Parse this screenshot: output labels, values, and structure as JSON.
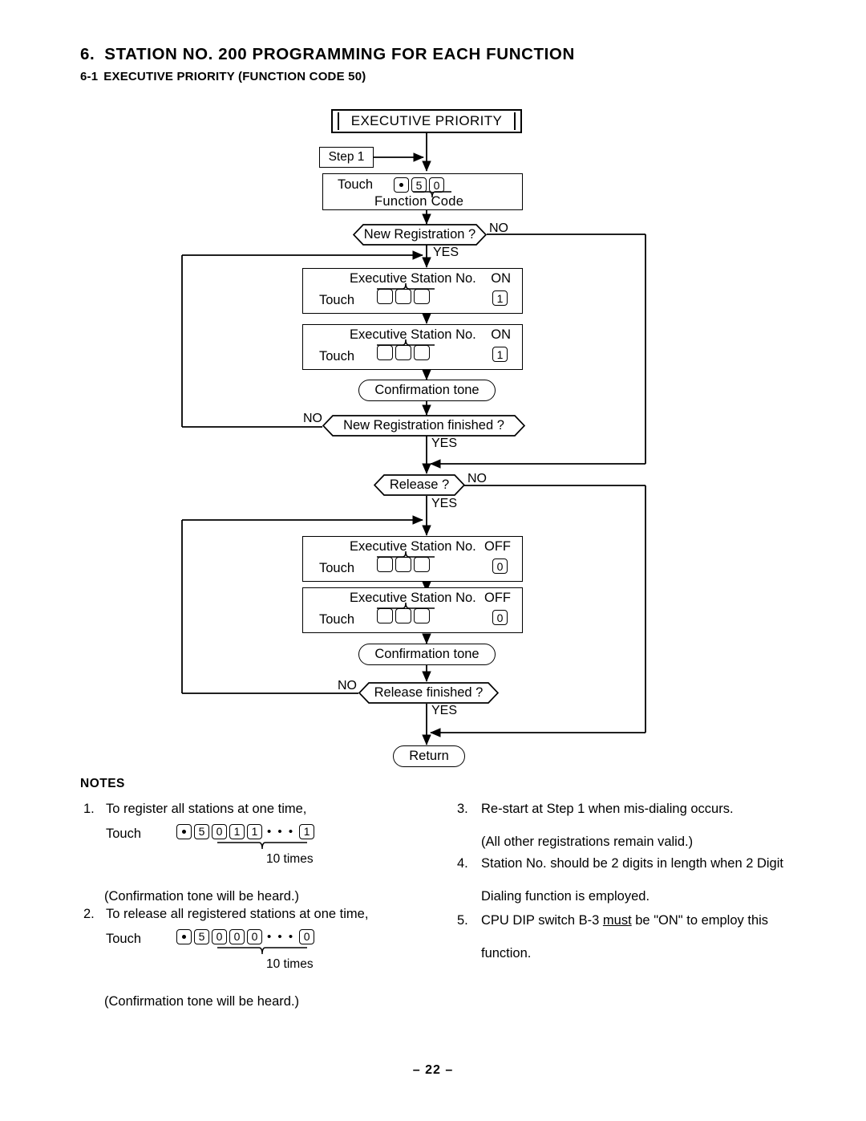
{
  "heading": {
    "section_number": "6.",
    "section_title": "STATION  NO. 200  PROGRAMMING  FOR  EACH  FUNCTION",
    "subsection_number": "6-1",
    "subsection_title": "EXECUTIVE PRIORITY (FUNCTION CODE 50)"
  },
  "flowchart": {
    "banner": "EXECUTIVE  PRIORITY",
    "step1": "Step 1",
    "function_code_box": {
      "touch_label": "Touch",
      "keys": [
        "•",
        "5",
        "0"
      ],
      "caption": "Function  Code"
    },
    "decision_new_registration": {
      "label": "New Registration ?",
      "yes": "YES",
      "no": "NO"
    },
    "on_box_1": {
      "header": "Executive Station No.",
      "state": "ON",
      "touch_label": "Touch",
      "blank_keys": [
        "",
        "",
        ""
      ],
      "state_key": "1"
    },
    "on_box_2": {
      "header": "Executive Station No.",
      "state": "ON",
      "touch_label": "Touch",
      "blank_keys": [
        "",
        "",
        ""
      ],
      "state_key": "1"
    },
    "confirmation_tone_1": "Confirmation tone",
    "decision_new_registration_finished": {
      "label": "New Registration finished ?",
      "yes": "YES",
      "no": "NO"
    },
    "decision_release": {
      "label": "Release ?",
      "yes": "YES",
      "no": "NO"
    },
    "off_box_1": {
      "header": "Executive Station No.",
      "state": "OFF",
      "touch_label": "Touch",
      "blank_keys": [
        "",
        "",
        ""
      ],
      "state_key": "0"
    },
    "off_box_2": {
      "header": "Executive Station No.",
      "state": "OFF",
      "touch_label": "Touch",
      "blank_keys": [
        "",
        "",
        ""
      ],
      "state_key": "0"
    },
    "confirmation_tone_2": "Confirmation tone",
    "decision_release_finished": {
      "label": "Release finished ?",
      "yes": "YES",
      "no": "NO"
    },
    "return": "Return"
  },
  "notes": {
    "title": "NOTES",
    "items": [
      {
        "index": "1.",
        "text": "To register all  stations at one time,",
        "touch_label": "Touch",
        "keys": [
          "•",
          "5",
          "0",
          "1",
          "1"
        ],
        "ellipsis": "• • •",
        "last_key": "1",
        "repeat_caption": "10 times",
        "footnote": "(Confirmation tone will be heard.)"
      },
      {
        "index": "2.",
        "text": "To release all  registered stations at one time,",
        "touch_label": "Touch",
        "keys": [
          "•",
          "5",
          "0",
          "0",
          "0"
        ],
        "ellipsis": "• • •",
        "last_key": "0",
        "repeat_caption": "10 times",
        "footnote": "(Confirmation tone will be heard.)"
      },
      {
        "index": "3.",
        "line1": "Re-start at Step 1 when mis-dialing occurs.",
        "line2": "(All other registrations remain valid.)"
      },
      {
        "index": "4.",
        "line1": "Station  No.  should  be  2 digits  in  length  when  2 Digit",
        "line2": "Dialing function is employed."
      },
      {
        "index": "5.",
        "line1_pre": "CPU  DIP  switch  B-3  ",
        "line1_emph": "must",
        "line1_post": "  be  \"ON\"  to  employ  this",
        "line2": "function."
      }
    ]
  },
  "page_number": "–  22 –",
  "colors": {
    "ink": "#000000",
    "paper": "#ffffff"
  }
}
